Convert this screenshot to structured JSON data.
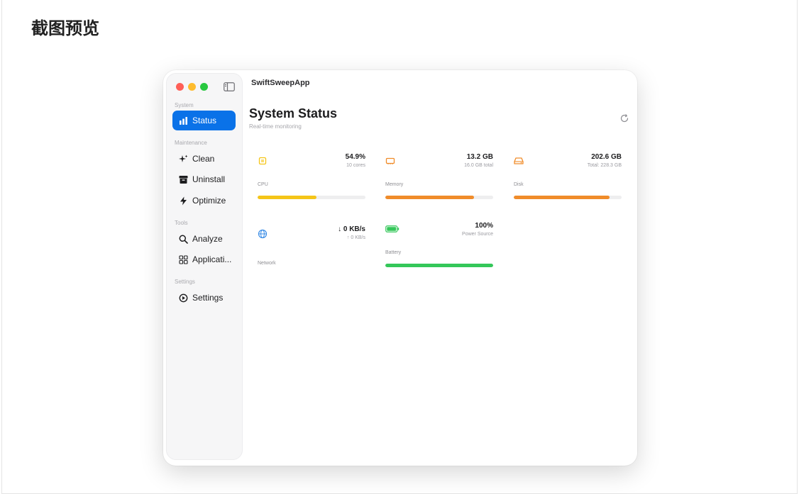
{
  "page": {
    "heading": "截图预览"
  },
  "window": {
    "title": "SwiftSweepApp"
  },
  "sidebar": {
    "sections": {
      "system": "System",
      "maintenance": "Maintenance",
      "tools": "Tools",
      "settings": "Settings"
    },
    "items": [
      {
        "label": "Status",
        "icon": "bar-chart-icon",
        "active": true
      },
      {
        "label": "Clean",
        "icon": "sparkle-icon",
        "active": false
      },
      {
        "label": "Uninstall",
        "icon": "trash-box-icon",
        "active": false
      },
      {
        "label": "Optimize",
        "icon": "bolt-icon",
        "active": false
      },
      {
        "label": "Analyze",
        "icon": "magnifier-icon",
        "active": false
      },
      {
        "label": "Applicati...",
        "icon": "grid-icon",
        "active": false
      },
      {
        "label": "Settings",
        "icon": "gear-icon",
        "active": false
      }
    ]
  },
  "main": {
    "title": "System Status",
    "subtitle": "Real-time monitoring"
  },
  "cards": {
    "cpu": {
      "label": "CPU",
      "value": "54.9%",
      "detail": "10 cores",
      "level": 0.549,
      "color": "#f5c518",
      "icon": "cpu-icon"
    },
    "memory": {
      "label": "Memory",
      "value": "13.2 GB",
      "detail": "16.0 GB total",
      "level": 0.82,
      "color": "#f08c2a",
      "icon": "memory-icon"
    },
    "disk": {
      "label": "Disk",
      "value": "202.6 GB",
      "detail": "Total: 228.3 GB",
      "level": 0.887,
      "color": "#f08c2a",
      "icon": "disk-icon"
    },
    "network": {
      "label": "Network",
      "down": "↓ 0 KB/s",
      "up": "↑ 0 KB/s",
      "icon": "globe-icon"
    },
    "battery": {
      "label": "Battery",
      "value": "100%",
      "detail": "Power Source",
      "level": 1.0,
      "color": "#34c759",
      "icon": "battery-icon"
    }
  },
  "colors": {
    "accent": "#0a72e8"
  }
}
